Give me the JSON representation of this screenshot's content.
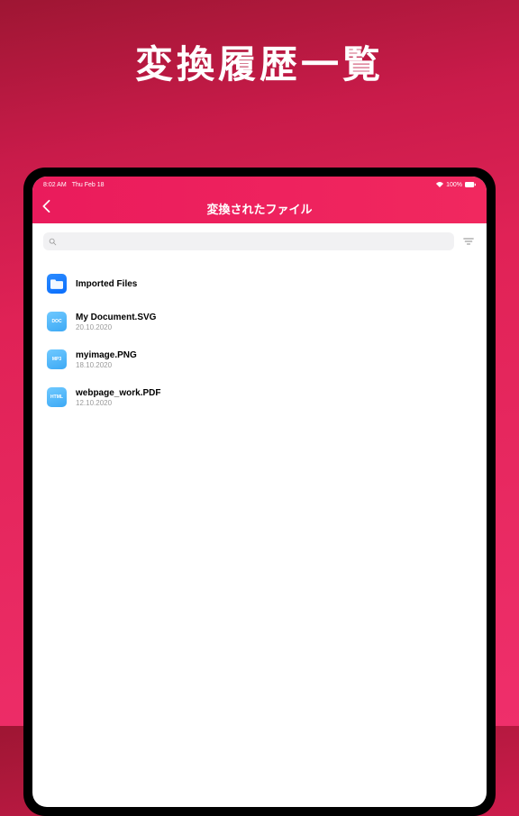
{
  "hero": {
    "title": "変換履歴一覧"
  },
  "statusbar": {
    "time": "8:02 AM",
    "date": "Thu Feb 18",
    "battery_pct": "100%"
  },
  "nav": {
    "title": "変換されたファイル"
  },
  "search": {
    "placeholder": ""
  },
  "files": [
    {
      "icon": "folder",
      "icon_label": "",
      "name": "Imported Files",
      "date": ""
    },
    {
      "icon": "doc",
      "icon_label": "DOC",
      "name": "My Document.SVG",
      "date": "20.10.2020"
    },
    {
      "icon": "mp3",
      "icon_label": "MP3",
      "name": "myimage.PNG",
      "date": "18.10.2020"
    },
    {
      "icon": "html",
      "icon_label": "HTML",
      "name": "webpage_work.PDF",
      "date": "12.10.2020"
    }
  ]
}
